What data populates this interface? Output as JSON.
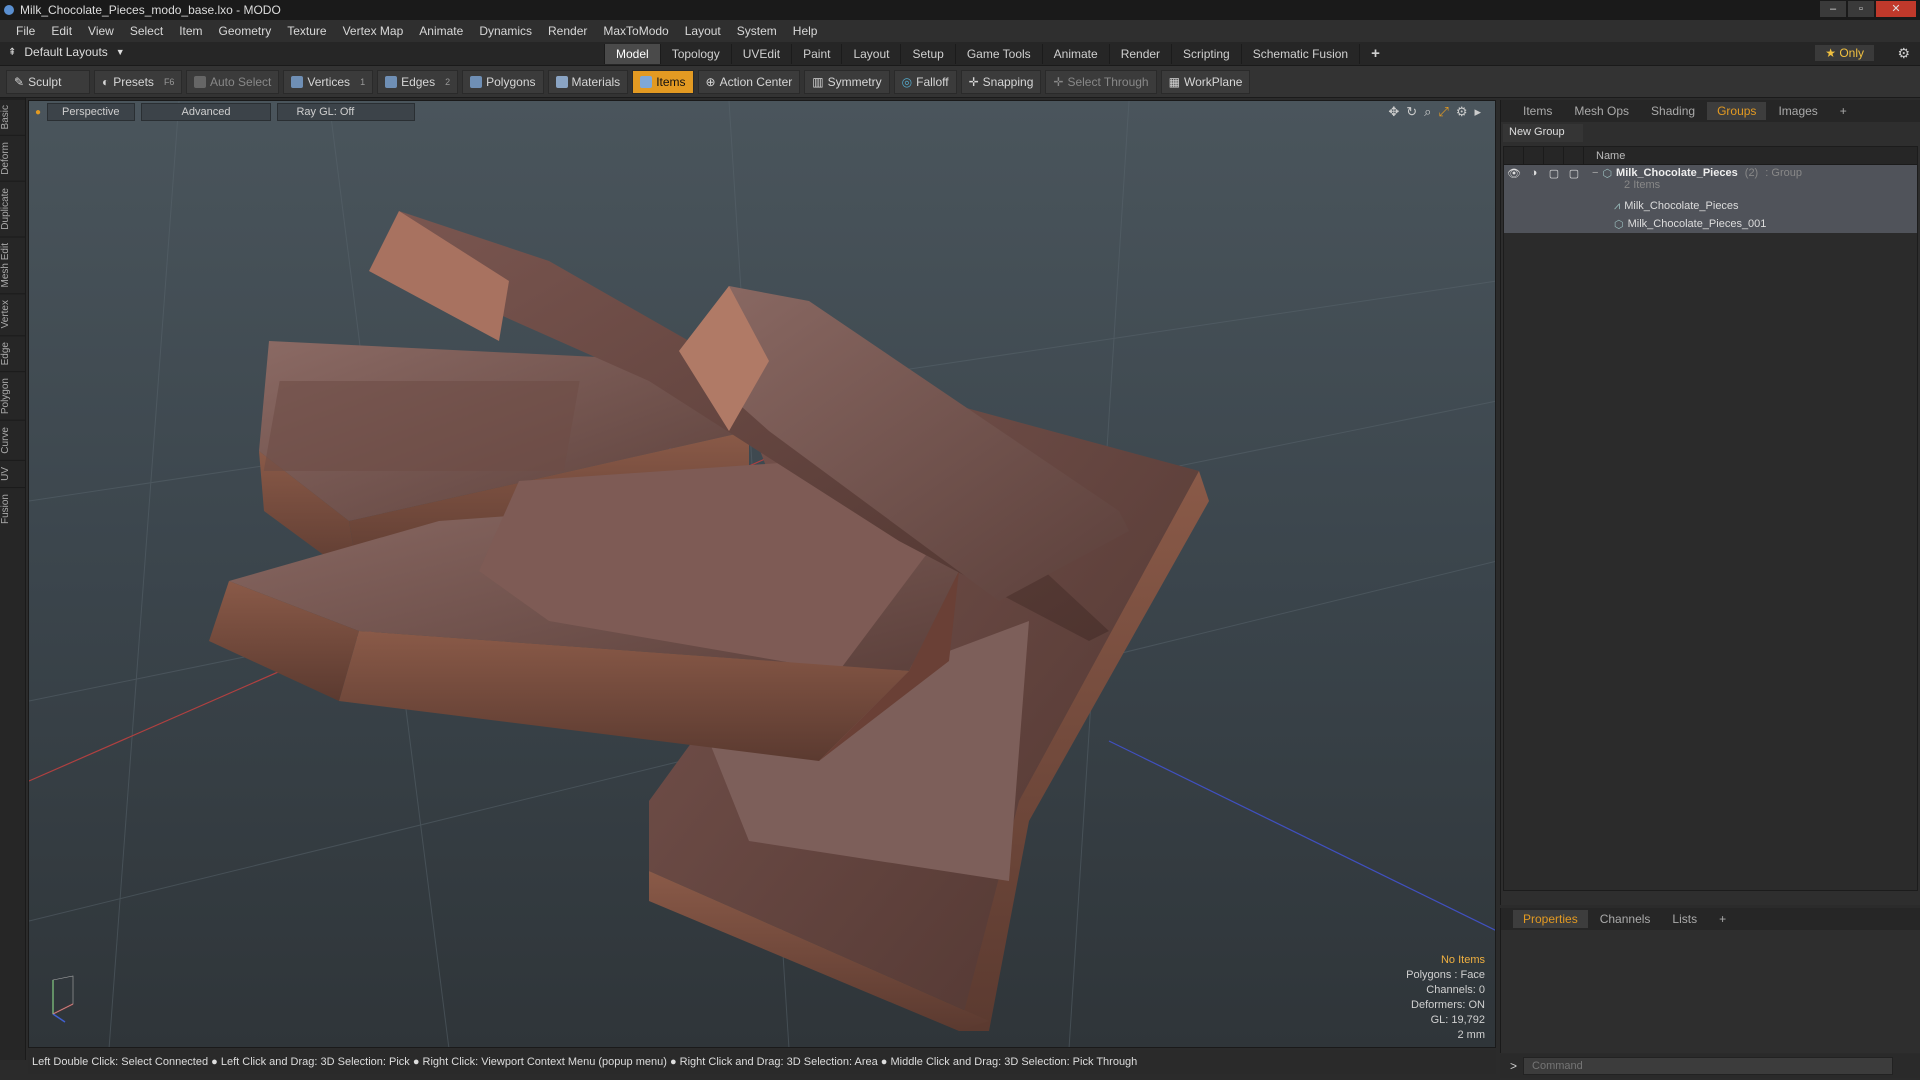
{
  "window": {
    "title": "Milk_Chocolate_Pieces_modo_base.lxo - MODO"
  },
  "menu": [
    "File",
    "Edit",
    "View",
    "Select",
    "Item",
    "Geometry",
    "Texture",
    "Vertex Map",
    "Animate",
    "Dynamics",
    "Render",
    "MaxToModo",
    "Layout",
    "System",
    "Help"
  ],
  "layouts": {
    "label": "Default Layouts"
  },
  "layout_tabs": [
    "Model",
    "Topology",
    "UVEdit",
    "Paint",
    "Layout",
    "Setup",
    "Game Tools",
    "Animate",
    "Render",
    "Scripting",
    "Schematic Fusion"
  ],
  "only_label": "Only",
  "toolbar": {
    "sculpt": "Sculpt",
    "presets": "Presets",
    "presets_key": "F6",
    "auto_select": "Auto Select",
    "vertices": "Vertices",
    "vertices_count": "1",
    "edges": "Edges",
    "edges_count": "2",
    "polygons": "Polygons",
    "materials": "Materials",
    "items": "Items",
    "action_center": "Action Center",
    "symmetry": "Symmetry",
    "falloff": "Falloff",
    "snapping": "Snapping",
    "select_through": "Select Through",
    "workplane": "WorkPlane"
  },
  "left_tabs": [
    "Basic",
    "Deform",
    "Duplicate",
    "Mesh Edit",
    "Vertex",
    "Edge",
    "Polygon",
    "Curve",
    "UV",
    "Fusion"
  ],
  "viewport": {
    "perspective": "Perspective",
    "advanced": "Advanced",
    "raygl": "Ray GL: Off",
    "info": {
      "no_items": "No Items",
      "polygons": "Polygons : Face",
      "channels": "Channels: 0",
      "deformers": "Deformers: ON",
      "gl": "GL: 19,792",
      "unit": "2 mm"
    }
  },
  "status": "Left Double Click: Select Connected ● Left Click and Drag: 3D Selection: Pick ● Right Click: Viewport Context Menu (popup menu) ● Right Click and Drag: 3D Selection: Area ● Middle Click and Drag: 3D Selection: Pick Through",
  "right_tabs": [
    "Items",
    "Mesh Ops",
    "Shading",
    "Groups",
    "Images"
  ],
  "right_active": "Groups",
  "new_group": "New Group",
  "tree": {
    "name_header": "Name",
    "group": {
      "name": "Milk_Chocolate_Pieces",
      "count": "(2)",
      "type": ": Group",
      "sub": "2 Items"
    },
    "items": [
      "Milk_Chocolate_Pieces",
      "Milk_Chocolate_Pieces_001"
    ]
  },
  "bottom_tabs": [
    "Properties",
    "Channels",
    "Lists"
  ],
  "command_placeholder": "Command"
}
